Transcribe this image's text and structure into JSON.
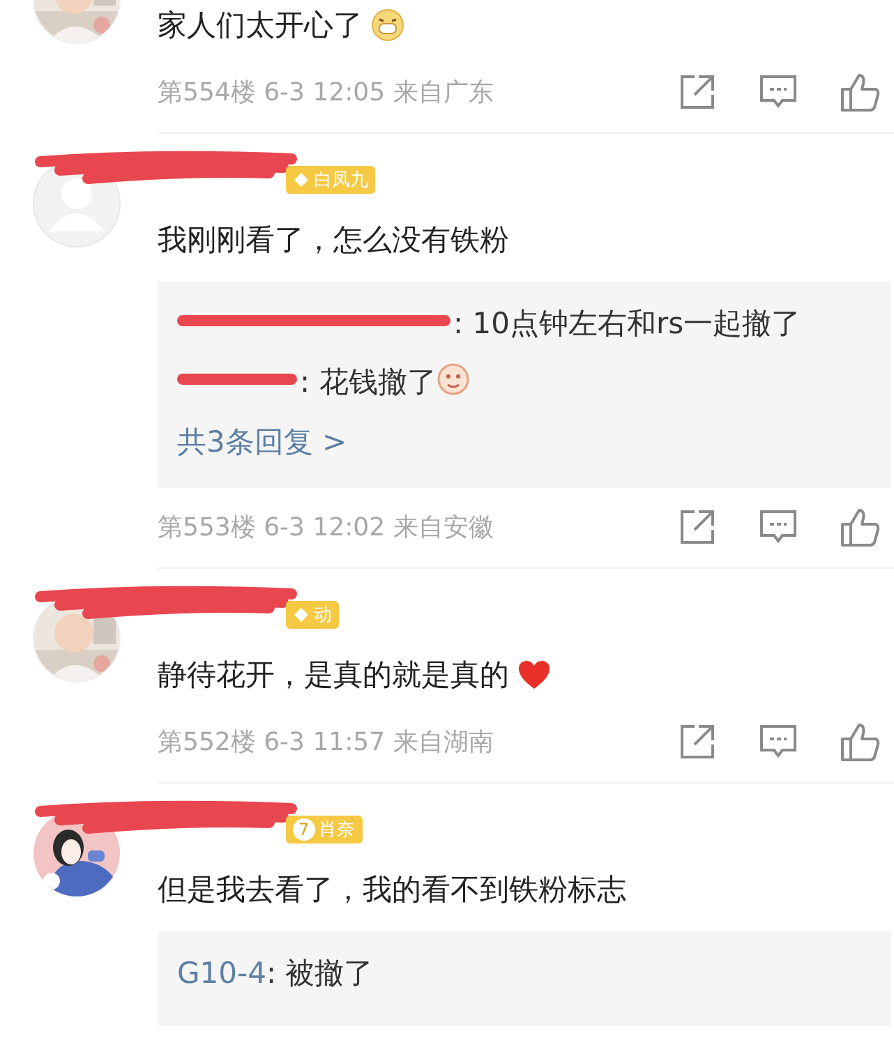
{
  "comments": [
    {
      "text": "家人们太开心了",
      "emoji": {
        "kind": "grin"
      },
      "floor": "第554楼",
      "time": "6-3 12:05",
      "location": "来自广东"
    },
    {
      "avatar": {
        "kind": "default"
      },
      "badge": {
        "label": "白凤九"
      },
      "text": "我刚刚看了，怎么没有铁粉",
      "replies": [
        {
          "text": ": 10点钟左右和rs一起撤了"
        },
        {
          "text": ": 花钱撤了",
          "emoji": {
            "kind": "sticker"
          }
        }
      ],
      "more_replies": "共3条回复 >",
      "floor": "第553楼",
      "time": "6-3 12:02",
      "location": "来自安徽"
    },
    {
      "badge": {
        "label": "动"
      },
      "text": "静待花开，是真的就是真的",
      "emoji": {
        "kind": "heart"
      },
      "floor": "第552楼",
      "time": "6-3 11:57",
      "location": "来自湖南"
    },
    {
      "avatar": {
        "kind": "drawing"
      },
      "badge": {
        "level": "7",
        "label": "肖奈"
      },
      "text": "但是我去看了，我的看不到铁粉标志",
      "replies": [
        {
          "author": "G10-4",
          "text": ": 被撤了"
        }
      ]
    }
  ]
}
